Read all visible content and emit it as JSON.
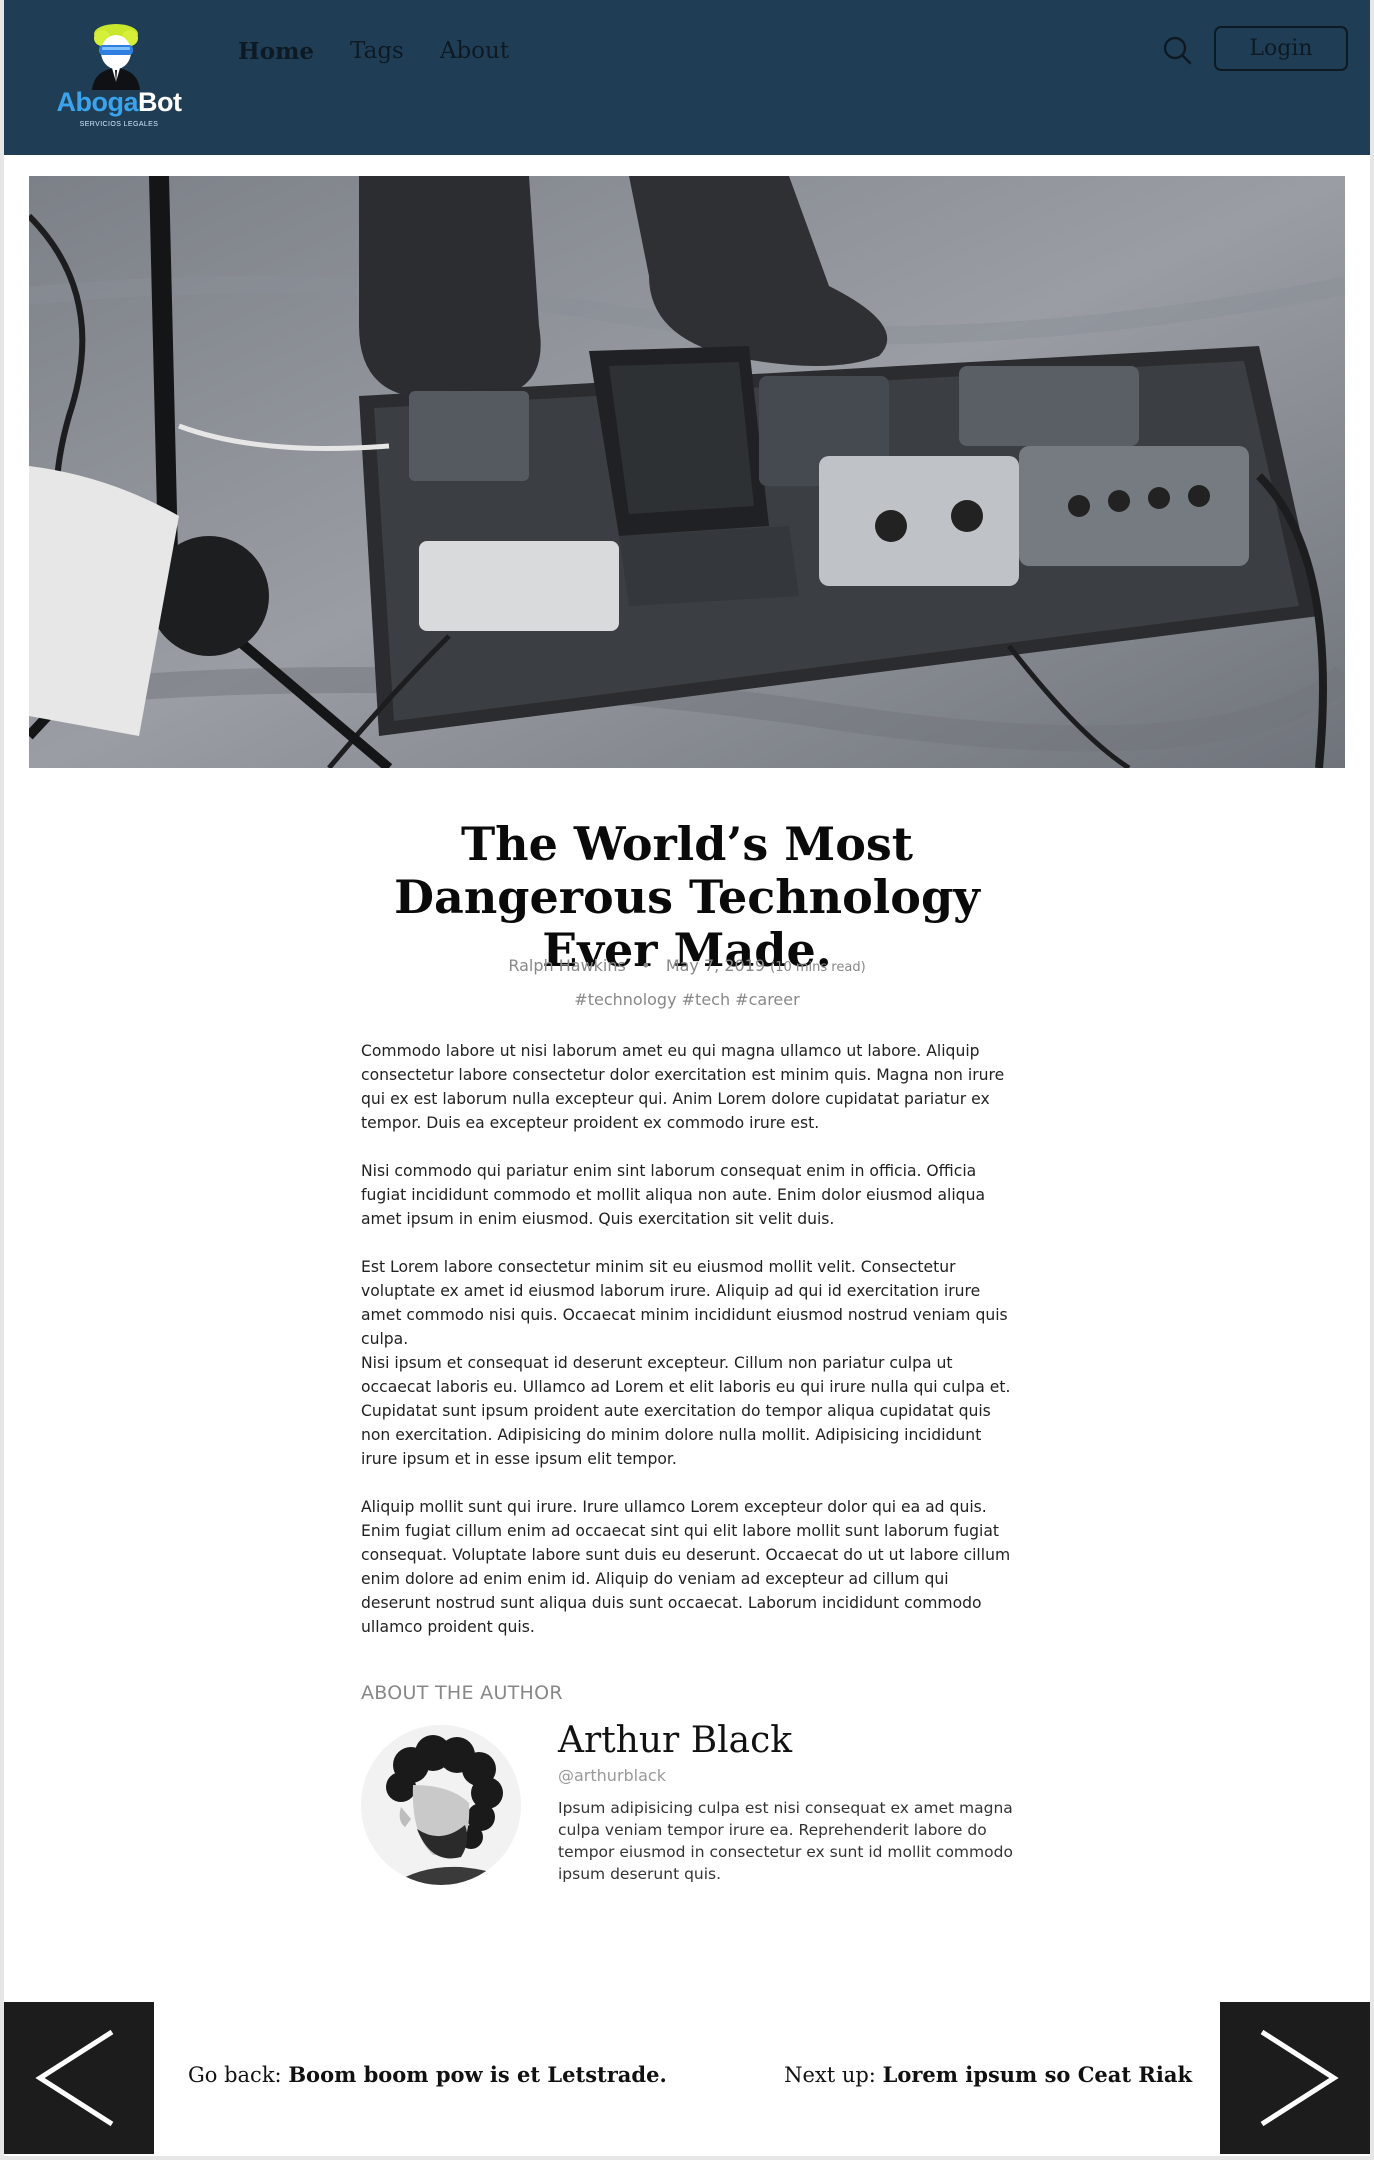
{
  "header": {
    "logo": {
      "part1": "Aboga",
      "part2": "Bot",
      "subtitle": "SERVICIOS LEGALES"
    },
    "nav": [
      {
        "label": "Home",
        "active": true
      },
      {
        "label": "Tags",
        "active": false
      },
      {
        "label": "About",
        "active": false
      }
    ],
    "search_icon": "search-icon",
    "login_label": "Login",
    "background_color": "#1f3e55"
  },
  "hero": {
    "alt": "guitar pedalboard"
  },
  "article": {
    "title": "The World’s Most Dangerous Technology Ever Made.",
    "author": "Ralph Hawkins",
    "separator": "•",
    "date": "May 7, 2019",
    "read_time": "(10 mins read)",
    "tags": "#technology #tech #career",
    "paragraphs": [
      "Commodo labore ut nisi laborum amet eu qui magna ullamco ut labore. Aliquip consectetur labore consectetur dolor exercitation est minim quis. Magna non irure qui ex est laborum nulla excepteur qui. Anim Lorem dolore cupidatat pariatur ex tempor. Duis ea excepteur proident ex commodo irure est.",
      "Nisi commodo qui pariatur enim sint laborum consequat enim in officia. Officia fugiat incididunt commodo et mollit aliqua non aute. Enim dolor eiusmod aliqua amet ipsum in enim eiusmod. Quis exercitation sit velit duis.",
      "Est Lorem labore consectetur minim sit eu eiusmod mollit velit. Consectetur voluptate ex amet id eiusmod laborum irure. Aliquip ad qui id exercitation irure amet commodo nisi quis. Occaecat minim incididunt eiusmod nostrud veniam quis culpa.",
      "Nisi ipsum et consequat id deserunt excepteur. Cillum non pariatur culpa ut occaecat laboris eu. Ullamco ad Lorem et elit laboris eu qui irure nulla qui culpa et. Cupidatat sunt ipsum proident aute exercitation do tempor aliqua cupidatat quis non exercitation. Adipisicing do minim dolore nulla mollit. Adipisicing incididunt irure ipsum et in esse ipsum elit tempor.",
      "Aliquip mollit sunt qui irure. Irure ullamco Lorem excepteur dolor qui ea ad quis. Enim fugiat cillum enim ad occaecat sint qui elit labore mollit sunt laborum fugiat consequat. Voluptate labore sunt duis eu deserunt. Occaecat do ut ut labore cillum enim dolore ad enim enim id. Aliquip do veniam ad excepteur ad cillum qui deserunt nostrud sunt aliqua duis sunt occaecat. Laborum incididunt commodo ullamco proident quis."
    ]
  },
  "author": {
    "section_label": "ABOUT THE AUTHOR",
    "name": "Arthur Black",
    "handle": "@arthurblack",
    "bio": "Ipsum adipisicing culpa est nisi consequat ex amet magna culpa veniam tempor irure ea. Reprehenderit labore do tempor eiusmod in consectetur ex sunt id mollit commodo ipsum deserunt quis."
  },
  "pager": {
    "prev_prefix": "Go back:",
    "prev_title": "Boom boom pow is et Letstrade.",
    "next_prefix": "Next up:",
    "next_title": "Lorem ipsum so Ceat Riak",
    "prev_icon": "chevron-left-icon",
    "next_icon": "chevron-right-icon"
  }
}
